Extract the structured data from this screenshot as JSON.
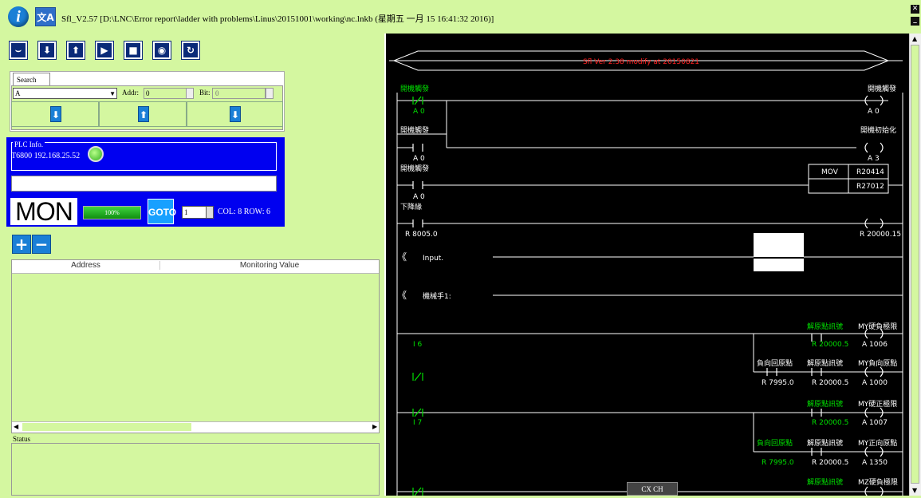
{
  "window": {
    "title": "Sfl_V2.57 [D:\\LNC\\Error report\\ladder with problems\\Linus\\20151001\\working\\nc.lnkb (星期五 一月 15 16:41:32 2016)]",
    "lang_icon": "文A"
  },
  "toolbar": {
    "icons": [
      "lamp-icon",
      "download-icon",
      "upload-icon",
      "play-icon",
      "stop-icon",
      "step-icon",
      "refresh-icon"
    ]
  },
  "search": {
    "tab_label": "Search",
    "device": "A",
    "addr_label": "Addr",
    "addr_value": "0",
    "bit_label": "Bit",
    "bit_value": "0"
  },
  "plc": {
    "title": "PLC Info.",
    "ip": "T6800 192.168.25.52",
    "mode": "MON",
    "progress_label": "100%",
    "progress": 100,
    "goto_label": "GOTO",
    "page": "1",
    "col_row": "COL: 8 ROW: 6"
  },
  "monitor": {
    "headers": [
      "Address",
      "Monitoring Value"
    ],
    "status_label": "Status"
  },
  "ladder": {
    "header": "Sfl Ver 2.38 modify at 20150821",
    "cx_label": "CX CH",
    "rungs": {
      "r1_contact_label": "開機觸發",
      "r1_contact_addr": "A 0",
      "r1_coil_label": "開機觸發",
      "r1_coil_addr": "A 0",
      "r2_contact_label": "開機觸發",
      "r2_contact_addr": "A 0",
      "r2_coil_label": "開機初始化",
      "r2_coil_addr": "A 3",
      "r3_contact_label": "開機觸發",
      "r3_contact_addr": "A 0",
      "r3_func": "MOV",
      "r3_op1": "R20414",
      "r3_op2": "R27012",
      "r4_contact_label": "下降緣",
      "r4_contact_addr": "R 8005.0",
      "r4_coil_addr": "R 20000.15",
      "comment1": "Input.",
      "comment2": "機械手1:",
      "r5_contact_addr": "I 6",
      "r5_c2_label": "解原點訊號",
      "r5_c2_addr": "R 20000.5",
      "r5_coil_label": "MY硬負極限",
      "r5_coil_addr": "A 1006",
      "r6_c1_label": "負向回原點",
      "r6_c1_addr": "R 7995.0",
      "r6_c2_label": "解原點訊號",
      "r6_c2_addr": "R 20000.5",
      "r6_coil_label": "MY負向原點",
      "r6_coil_addr": "A 1000",
      "r7_contact_addr": "I 7",
      "r7_c2_label": "解原點訊號",
      "r7_c2_addr": "R 20000.5",
      "r7_coil_label": "MY硬正極限",
      "r7_coil_addr": "A 1007",
      "r8_c1_label": "負向回原點",
      "r8_c1_addr": "R 7995.0",
      "r8_c2_label": "解原點訊號",
      "r8_c2_addr": "R 20000.5",
      "r8_coil_label": "MY正向原點",
      "r8_coil_addr": "A 1350",
      "r9_c2_label": "解原點訊號",
      "r9_coil_label": "MZ硬負極限"
    }
  },
  "colors": {
    "panel_bg": "#d4f7a0",
    "plc_bg": "#0000f0",
    "ladder_bg": "#000000",
    "ladder_green": "#00e000",
    "ladder_header_red": "#ff2020"
  }
}
